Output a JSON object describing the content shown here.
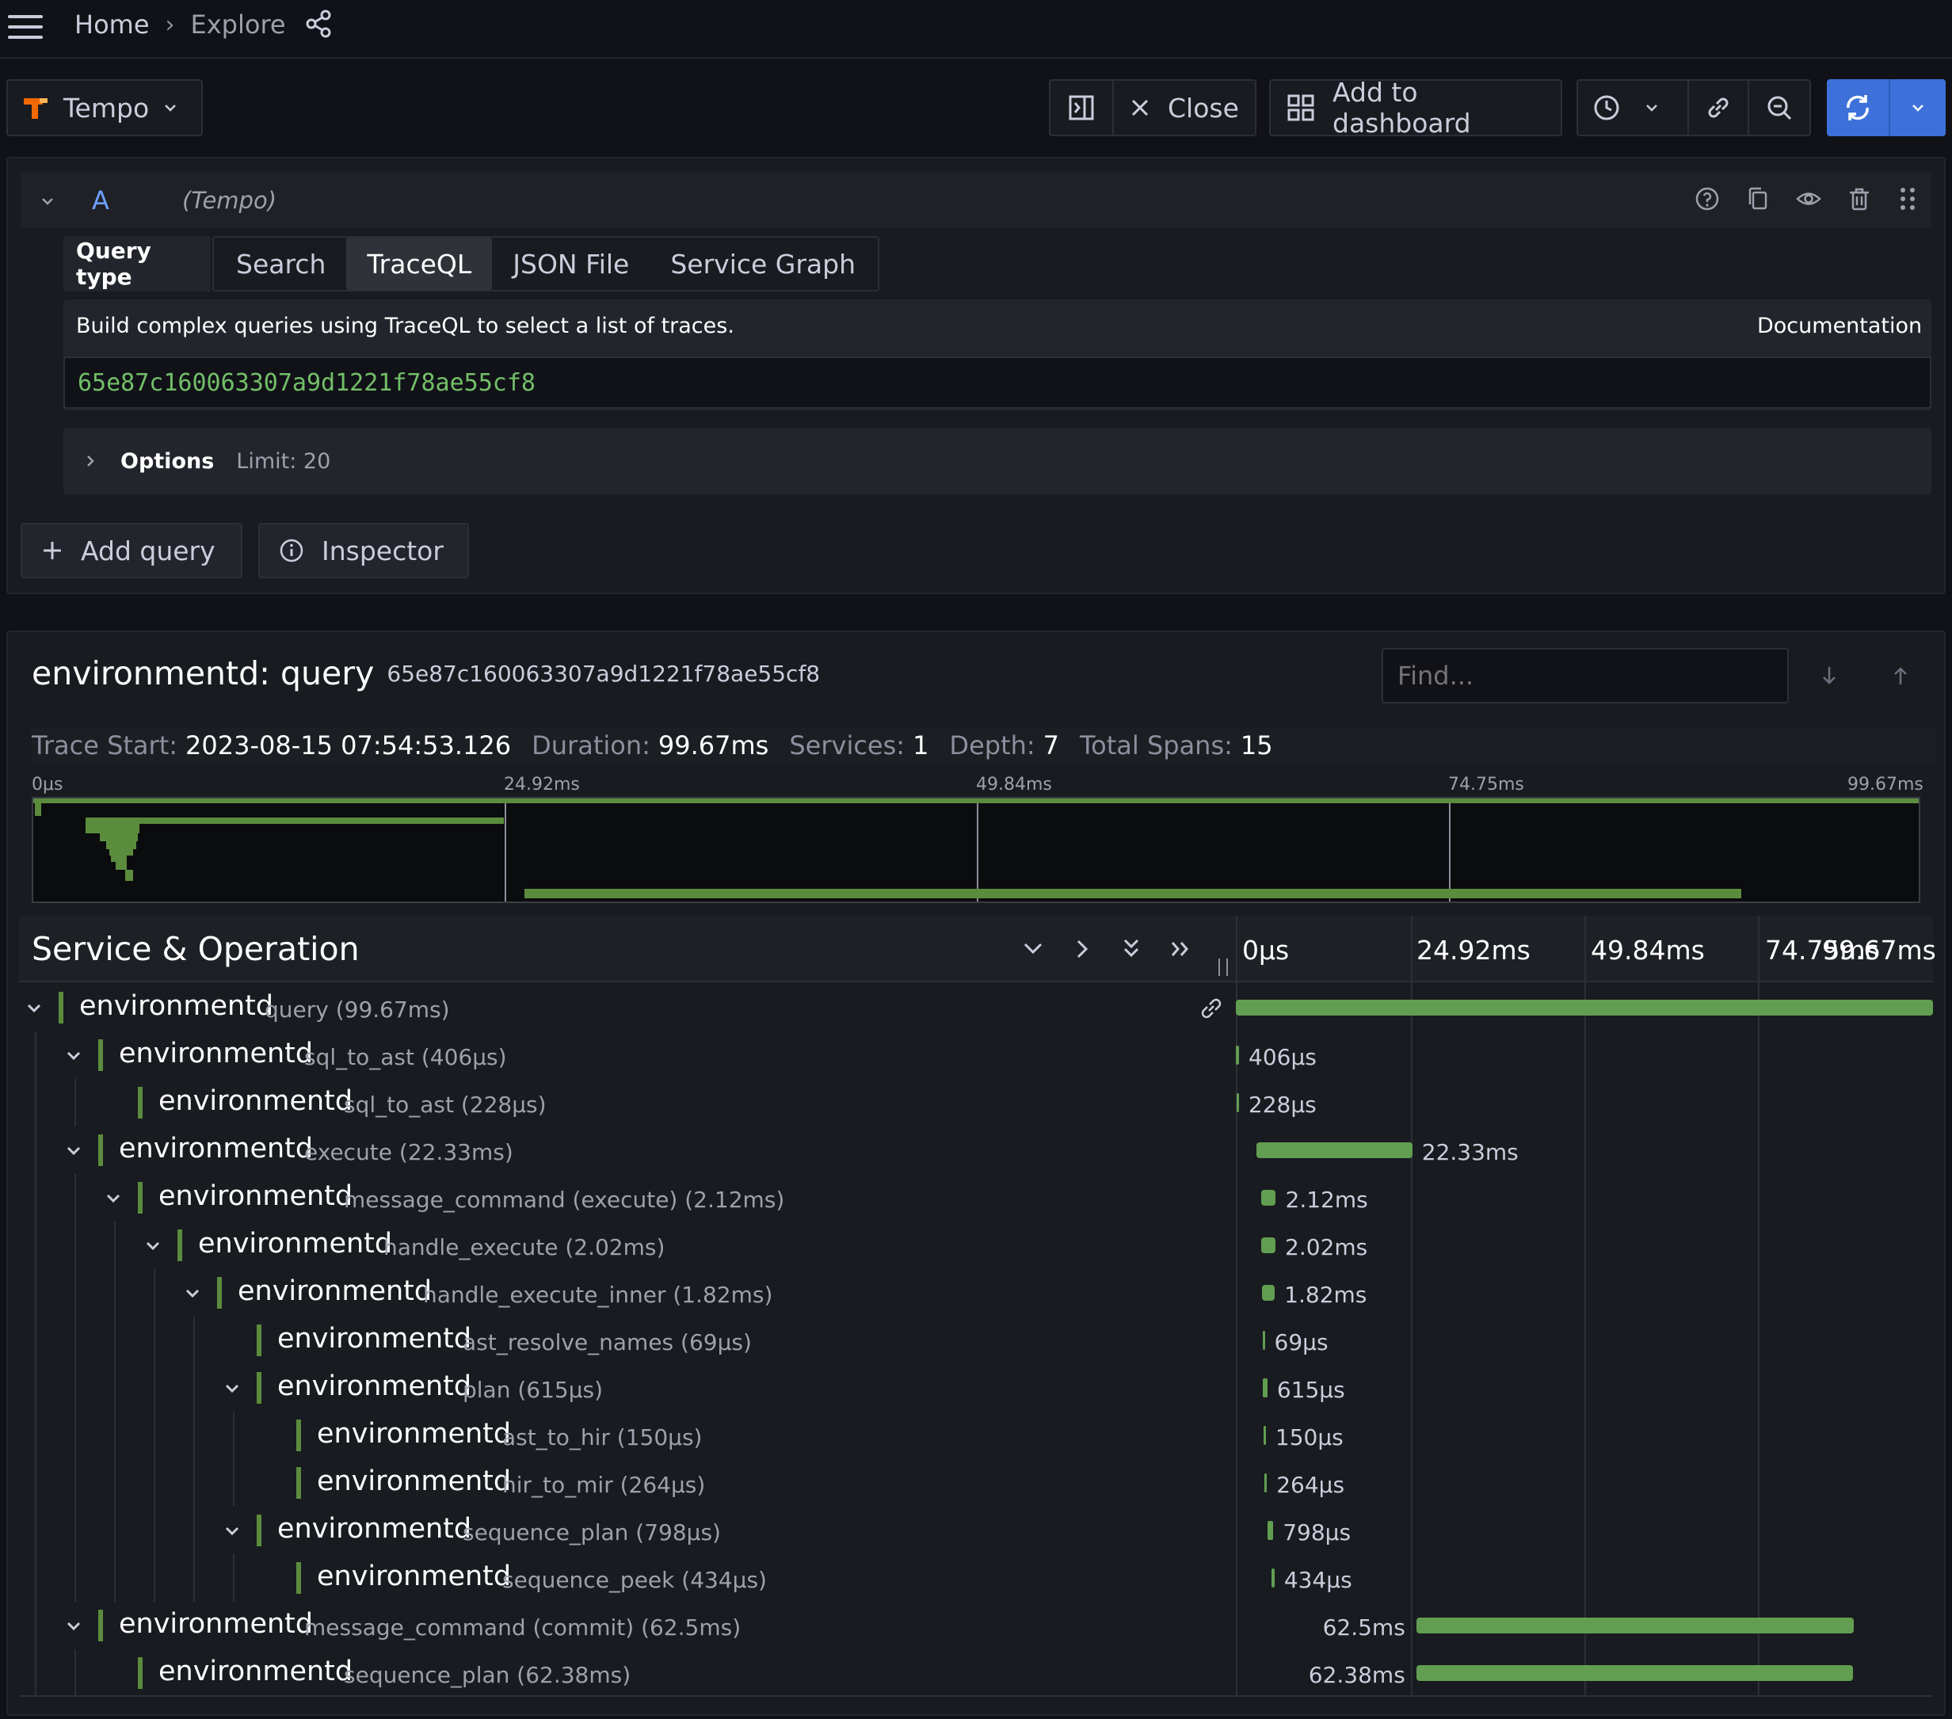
{
  "breadcrumb": {
    "home": "Home",
    "separator": "›",
    "current": "Explore"
  },
  "toolbar": {
    "datasource": "Tempo",
    "close_label": "Close",
    "add_to_dashboard_label": "Add to dashboard"
  },
  "query": {
    "ref_id": "A",
    "datasource_hint": "(Tempo)",
    "query_type_label": "Query type",
    "tabs": [
      "Search",
      "TraceQL",
      "JSON File",
      "Service Graph"
    ],
    "active_tab": "TraceQL",
    "description": "Build complex queries using TraceQL to select a list of traces.",
    "documentation_label": "Documentation",
    "value": "65e87c160063307a9d1221f78ae55cf8",
    "options_label": "Options",
    "limit_text": "Limit: 20"
  },
  "query_actions": {
    "add_query": "Add query",
    "inspector": "Inspector"
  },
  "trace": {
    "title": "environmentd: query",
    "trace_id": "65e87c160063307a9d1221f78ae55cf8",
    "find_placeholder": "Find...",
    "stats": {
      "start_label": "Trace Start:",
      "start_value": "2023-08-15 07:54:53.126",
      "duration_label": "Duration:",
      "duration_value": "99.67ms",
      "services_label": "Services:",
      "services_value": "1",
      "depth_label": "Depth:",
      "depth_value": "7",
      "spans_label": "Total Spans:",
      "spans_value": "15"
    },
    "minimap_ticks": [
      "0μs",
      "24.92ms",
      "49.84ms",
      "74.75ms",
      "99.67ms"
    ],
    "header_title": "Service & Operation",
    "timeline_ticks": [
      "0μs",
      "24.92ms",
      "49.84ms",
      "74.75ms",
      "99.67ms"
    ],
    "total_ms": 99.67,
    "spans": [
      {
        "service": "environmentd",
        "op": "query (99.67ms)",
        "depth": 0,
        "collapsible": true,
        "start_ms": 0,
        "dur_ms": 99.67,
        "dur_label": "",
        "label_left": false,
        "link": true
      },
      {
        "service": "environmentd",
        "op": "sql_to_ast (406μs)",
        "depth": 1,
        "collapsible": true,
        "start_ms": 0.05,
        "dur_ms": 0.406,
        "dur_label": "406μs",
        "label_left": false
      },
      {
        "service": "environmentd",
        "op": "sql_to_ast (228μs)",
        "depth": 2,
        "collapsible": false,
        "start_ms": 0.1,
        "dur_ms": 0.228,
        "dur_label": "228μs",
        "label_left": false
      },
      {
        "service": "environmentd",
        "op": "execute (22.33ms)",
        "depth": 1,
        "collapsible": true,
        "start_ms": 2.9,
        "dur_ms": 22.33,
        "dur_label": "22.33ms",
        "label_left": false
      },
      {
        "service": "environmentd",
        "op": "message_command (execute) (2.12ms)",
        "depth": 2,
        "collapsible": true,
        "start_ms": 3.6,
        "dur_ms": 2.12,
        "dur_label": "2.12ms",
        "label_left": false
      },
      {
        "service": "environmentd",
        "op": "handle_execute (2.02ms)",
        "depth": 3,
        "collapsible": true,
        "start_ms": 3.65,
        "dur_ms": 2.02,
        "dur_label": "2.02ms",
        "label_left": false
      },
      {
        "service": "environmentd",
        "op": "handle_execute_inner (1.82ms)",
        "depth": 4,
        "collapsible": true,
        "start_ms": 3.75,
        "dur_ms": 1.82,
        "dur_label": "1.82ms",
        "label_left": false
      },
      {
        "service": "environmentd",
        "op": "ast_resolve_names (69μs)",
        "depth": 5,
        "collapsible": false,
        "start_ms": 3.8,
        "dur_ms": 0.069,
        "dur_label": "69μs",
        "label_left": false
      },
      {
        "service": "environmentd",
        "op": "plan (615μs)",
        "depth": 5,
        "collapsible": true,
        "start_ms": 3.9,
        "dur_ms": 0.615,
        "dur_label": "615μs",
        "label_left": false
      },
      {
        "service": "environmentd",
        "op": "ast_to_hir (150μs)",
        "depth": 6,
        "collapsible": false,
        "start_ms": 3.95,
        "dur_ms": 0.15,
        "dur_label": "150μs",
        "label_left": false
      },
      {
        "service": "environmentd",
        "op": "hir_to_mir (264μs)",
        "depth": 6,
        "collapsible": false,
        "start_ms": 4.1,
        "dur_ms": 0.264,
        "dur_label": "264μs",
        "label_left": false
      },
      {
        "service": "environmentd",
        "op": "sequence_plan (798μs)",
        "depth": 5,
        "collapsible": true,
        "start_ms": 4.55,
        "dur_ms": 0.798,
        "dur_label": "798μs",
        "label_left": false
      },
      {
        "service": "environmentd",
        "op": "sequence_peek (434μs)",
        "depth": 6,
        "collapsible": false,
        "start_ms": 5.1,
        "dur_ms": 0.434,
        "dur_label": "434μs",
        "label_left": false
      },
      {
        "service": "environmentd",
        "op": "message_command (commit) (62.5ms)",
        "depth": 1,
        "collapsible": true,
        "start_ms": 25.8,
        "dur_ms": 62.5,
        "dur_label": "62.5ms",
        "label_left": true
      },
      {
        "service": "environmentd",
        "op": "sequence_plan (62.38ms)",
        "depth": 2,
        "collapsible": false,
        "start_ms": 25.8,
        "dur_ms": 62.38,
        "dur_label": "62.38ms",
        "label_left": true
      }
    ]
  },
  "colors": {
    "accent": "#3d71d9",
    "span": "#629e51",
    "query_text": "#73bf69",
    "ref_id": "#6e9fff"
  },
  "icons": [
    "menu-icon",
    "chevron-right-icon",
    "share-icon",
    "tempo-logo-icon",
    "chevron-down-icon",
    "split-pane-icon",
    "close-icon",
    "dashboard-grid-icon",
    "clock-icon",
    "link-icon",
    "zoom-out-icon",
    "refresh-icon",
    "help-icon",
    "copy-icon",
    "eye-icon",
    "trash-icon",
    "drag-icon",
    "plus-icon",
    "info-icon",
    "arrow-down-icon",
    "arrow-up-icon",
    "double-chevron-down-icon",
    "double-chevron-right-icon"
  ]
}
